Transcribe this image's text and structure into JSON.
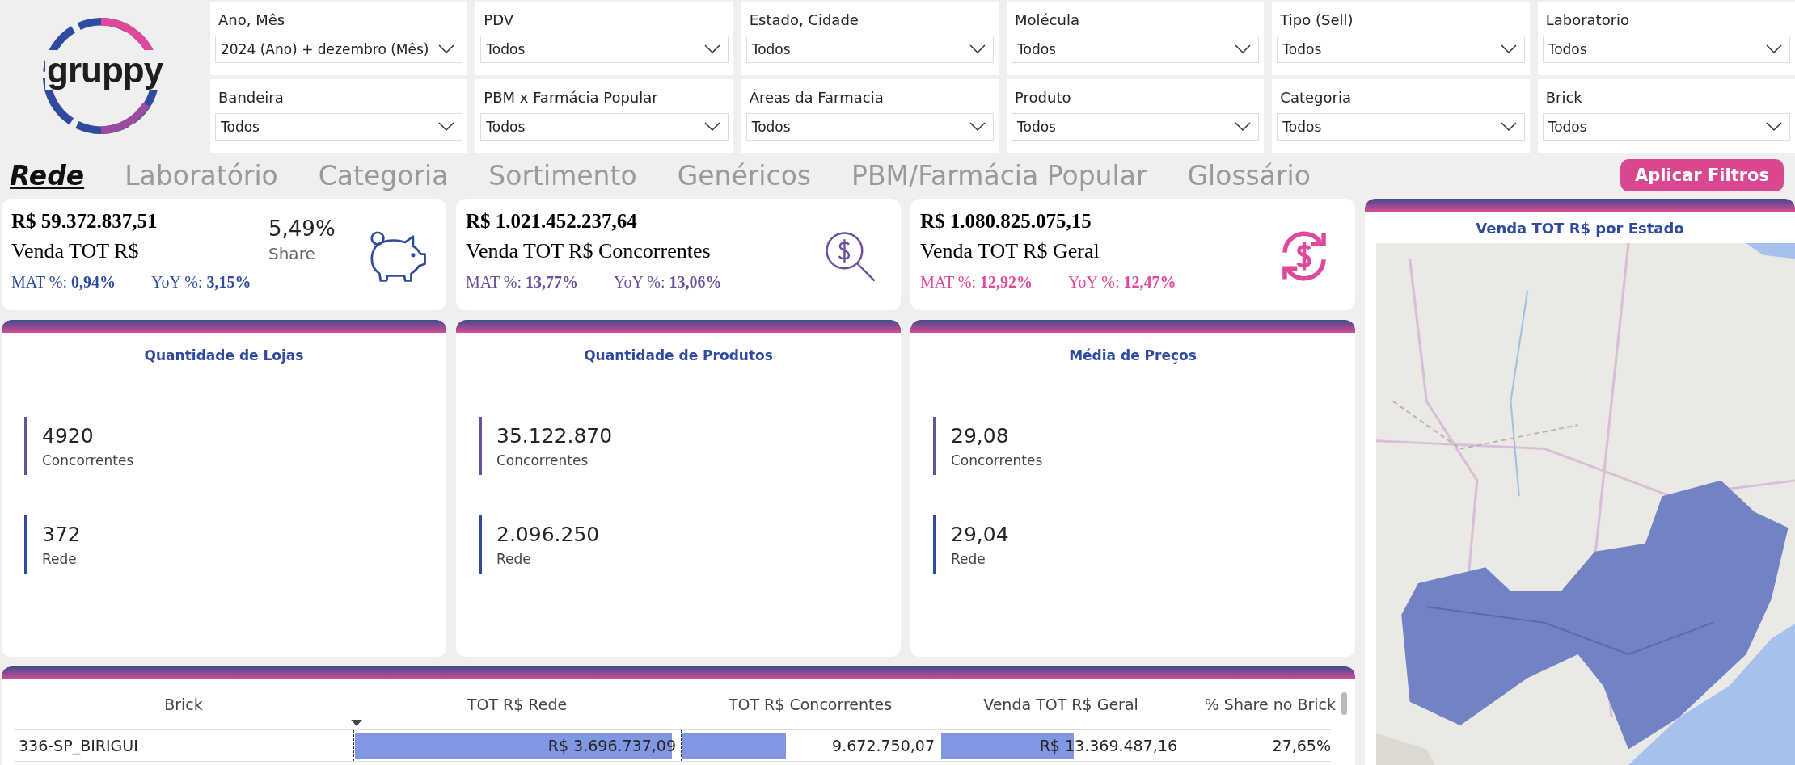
{
  "logo": {
    "text": "gruppy"
  },
  "filters": [
    {
      "label": "Ano, Mês",
      "value": "2024 (Ano) + dezembro (Mês)"
    },
    {
      "label": "PDV",
      "value": "Todos"
    },
    {
      "label": "Estado, Cidade",
      "value": "Todos"
    },
    {
      "label": "Molécula",
      "value": "Todos"
    },
    {
      "label": "Tipo (Sell)",
      "value": "Todos"
    },
    {
      "label": "Laboratorio",
      "value": "Todos"
    },
    {
      "label": "Bandeira",
      "value": "Todos"
    },
    {
      "label": "PBM x Farmácia Popular",
      "value": "Todos"
    },
    {
      "label": "Áreas da Farmacia",
      "value": "Todos"
    },
    {
      "label": "Produto",
      "value": "Todos"
    },
    {
      "label": "Categoria",
      "value": "Todos"
    },
    {
      "label": "Brick",
      "value": "Todos"
    }
  ],
  "tabs": [
    {
      "label": "Rede",
      "selected": true
    },
    {
      "label": "Laboratório",
      "selected": false
    },
    {
      "label": "Categoria",
      "selected": false
    },
    {
      "label": "Sortimento",
      "selected": false
    },
    {
      "label": "Genéricos",
      "selected": false
    },
    {
      "label": "PBM/Farmácia Popular",
      "selected": false
    },
    {
      "label": "Glossário",
      "selected": false
    }
  ],
  "apply_button": "Aplicar Filtros",
  "kpi_cards": [
    {
      "kind": "piggy-bank",
      "color": "#2f4b9e",
      "value": "R$ 59.372.837,51",
      "label": "Venda TOT R$",
      "share": {
        "value": "5,49%",
        "label": "Share"
      },
      "mat_label": "MAT %:",
      "mat_value": "0,94%",
      "yoy_label": "YoY %:",
      "yoy_value": "3,15%"
    },
    {
      "kind": "search-dollar",
      "color": "#6b4f9a",
      "value": "R$ 1.021.452.237,64",
      "label": "Venda TOT R$ Concorrentes",
      "mat_label": "MAT %:",
      "mat_value": "13,77%",
      "yoy_label": "YoY %:",
      "yoy_value": "13,06%"
    },
    {
      "kind": "exchange-dollar",
      "color": "#e0489a",
      "value": "R$ 1.080.825.075,15",
      "label": "Venda TOT R$ Geral",
      "mat_label": "MAT %:",
      "mat_value": "12,92%",
      "yoy_label": "YoY %:",
      "yoy_value": "12,47%"
    }
  ],
  "metric_cards": [
    {
      "title": "Quantidade de Lojas",
      "items": [
        {
          "value": "4920",
          "label": "Concorrentes",
          "color": "#6b4f9a"
        },
        {
          "value": "372",
          "label": "Rede",
          "color": "#2f4b9e"
        }
      ]
    },
    {
      "title": "Quantidade de Produtos",
      "items": [
        {
          "value": "35.122.870",
          "label": "Concorrentes",
          "color": "#6b4f9a"
        },
        {
          "value": "2.096.250",
          "label": "Rede",
          "color": "#2f4b9e"
        }
      ]
    },
    {
      "title": "Média de Preços",
      "items": [
        {
          "value": "29,08",
          "label": "Concorrentes",
          "color": "#6b4f9a"
        },
        {
          "value": "29,04",
          "label": "Rede",
          "color": "#2f4b9e"
        }
      ]
    }
  ],
  "map": {
    "title": "Venda TOT R$ por Estado",
    "kind": "picture"
  },
  "table": {
    "columns": [
      {
        "label": "Brick",
        "sorted": false
      },
      {
        "label": "TOT R$ Rede",
        "sorted": true
      },
      {
        "label": "TOT R$ Concorrentes",
        "sorted": false
      },
      {
        "label": "Venda TOT R$ Geral",
        "sorted": false
      },
      {
        "label": "% Share no Brick",
        "sorted": false
      }
    ],
    "rows": [
      {
        "cells": [
          {
            "text": "336-SP_BIRIGUI"
          },
          {
            "text": "R$ 3.696.737,09",
            "level": 0.97
          },
          {
            "text": "9.672.750,07",
            "level": 0.4
          },
          {
            "text": "R$ 13.369.487,16",
            "level": 0.55
          },
          {
            "text": "27,65%"
          }
        ]
      }
    ]
  }
}
